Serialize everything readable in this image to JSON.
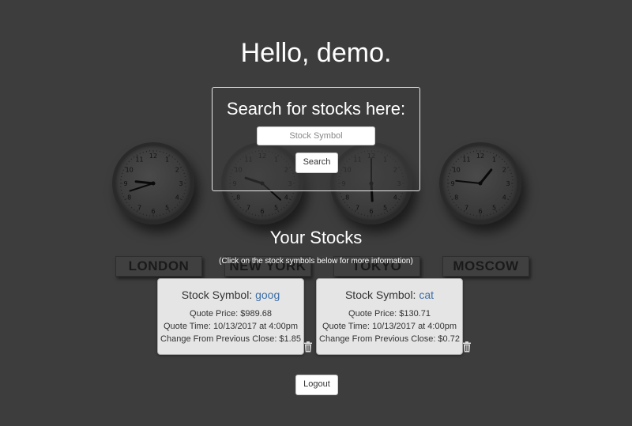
{
  "greeting": "Hello, demo.",
  "search": {
    "heading": "Search for stocks here:",
    "placeholder": "Stock Symbol",
    "value": "",
    "button_label": "Search"
  },
  "background": {
    "cities": [
      "LONDON",
      "NEW YORK",
      "TOKYO",
      "MOSCOW"
    ]
  },
  "stocks_section": {
    "title": "Your Stocks",
    "hint": "(Click on the stock symbols below for more information)"
  },
  "stocks": [
    {
      "label": "Stock Symbol: ",
      "symbol": "goog",
      "quote_price": "Quote Price: $989.68",
      "quote_time": "Quote Time: 10/13/2017 at 4:00pm",
      "change": "Change From Previous Close: $1.85"
    },
    {
      "label": "Stock Symbol: ",
      "symbol": "cat",
      "quote_price": "Quote Price: $130.71",
      "quote_time": "Quote Time: 10/13/2017 at 4:00pm",
      "change": "Change From Previous Close: $0.72"
    }
  ],
  "logout_label": "Logout",
  "icons": {
    "delete": "trash-icon"
  },
  "colors": {
    "background": "#3d3d3d",
    "link": "#3d6fa6",
    "card": "#e5e5e5"
  }
}
